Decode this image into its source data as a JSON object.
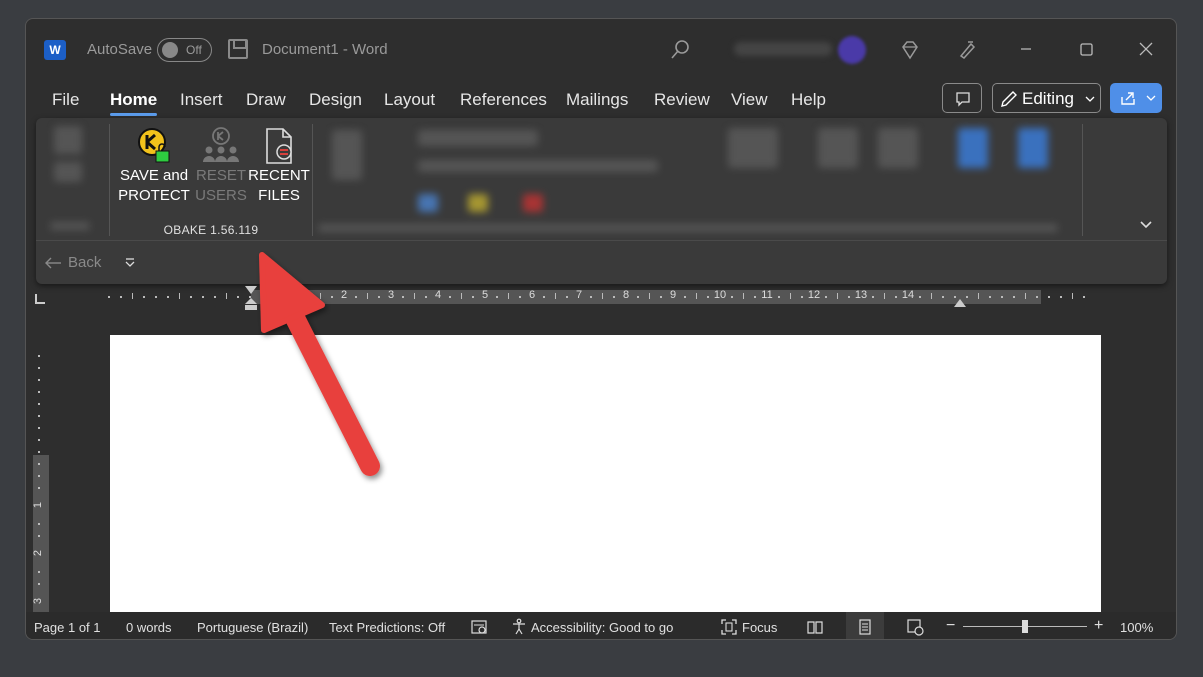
{
  "titlebar": {
    "app_icon_letter": "W",
    "autosave_label": "AutoSave",
    "autosave_state": "Off",
    "document_title": "Document1  -  Word"
  },
  "tabs": [
    "File",
    "Home",
    "Insert",
    "Draw",
    "Design",
    "Layout",
    "References",
    "Mailings",
    "Review",
    "View",
    "Help"
  ],
  "active_tab": "Home",
  "editing_mode": "Editing",
  "ribbon": {
    "obake_group_label": "OBAKE 1.56.119",
    "save_protect": {
      "line1": "SAVE and",
      "line2": "PROTECT"
    },
    "reset_users": {
      "line1": "RESET",
      "line2": "USERS"
    },
    "recent_files": {
      "line1": "RECENT",
      "line2": "FILES"
    }
  },
  "quick_access": {
    "back_label": "Back"
  },
  "ruler": {
    "h_numbers": [
      "2",
      "3",
      "4",
      "5",
      "6",
      "7",
      "8",
      "9",
      "10",
      "11",
      "12",
      "13",
      "14"
    ],
    "v_numbers": [
      "1",
      "2",
      "3"
    ]
  },
  "statusbar": {
    "page": "Page 1 of 1",
    "words": "0 words",
    "language": "Portuguese (Brazil)",
    "text_predictions": "Text Predictions: Off",
    "accessibility": "Accessibility: Good to go",
    "focus": "Focus",
    "zoom_minus": "−",
    "zoom_plus": "+",
    "zoom_level": "100%"
  },
  "colors": {
    "accent": "#5c9ded",
    "share_button": "#4f8fe8",
    "annotation_arrow": "#e8413c",
    "keylock_yellow": "#f2c21b",
    "keylock_green": "#2ecc40"
  }
}
